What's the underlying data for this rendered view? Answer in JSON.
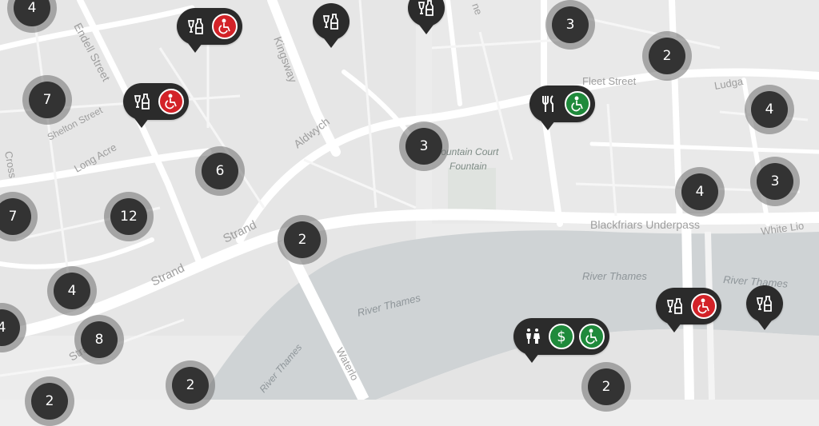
{
  "map": {
    "street_labels": {
      "endell": "Endell Street",
      "shelton": "Shelton Street",
      "long_acre": "Long Acre",
      "kingsway": "Kingsway",
      "aldwych": "Aldwych",
      "strand1": "Strand",
      "strand2": "Strand",
      "strand3": "Strand",
      "waterloo": "Waterlo",
      "fleet": "Fleet Street",
      "ludgate": "Ludga",
      "blackfriars": "Blackfriars Underpass",
      "white_lion": "White Lio",
      "crosswall": "Cross",
      "fountain1": "Fountain Court",
      "fountain2": "Fountain",
      "river1": "River Thames",
      "river2": "River Thames",
      "river3": "River Thames",
      "river4": "River Thames",
      "partial_ne": "ne"
    },
    "clusters": {
      "c1": "4",
      "c2": "7",
      "c3": "7",
      "c4": "12",
      "c5": "6",
      "c6": "4",
      "c7": "4",
      "c8": "8",
      "c9": "2",
      "c10": "2",
      "c11": "3",
      "c12": "3",
      "c13": "2",
      "c14": "4",
      "c15": "3",
      "c16": "4",
      "c17": "2",
      "c18": "2"
    }
  },
  "colors": {
    "accessible_red": "#d32228",
    "accessible_green": "#1f8a3b",
    "marker": "#2b2b2b",
    "cluster": "#333333",
    "river": "#cfd3d5"
  },
  "icons": {
    "drinks": "bottle-glass-icon",
    "restaurant": "fork-knife-icon",
    "toilets": "toilets-icon",
    "payment": "dollar-icon",
    "accessible": "wheelchair-icon"
  }
}
